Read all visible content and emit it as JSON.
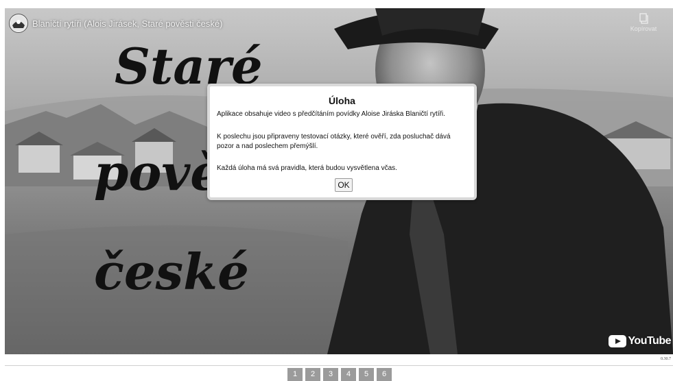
{
  "video": {
    "title": "Blaničtí rytíři (Alois Jirásek, Staré pověsti české)",
    "overlay_words": [
      "Staré",
      "pově",
      "české"
    ],
    "copy_label": "Kopírovat",
    "youtube_label": "YouTube"
  },
  "dialog": {
    "title": "Úloha",
    "paragraph1": "Aplikace obsahuje video s předčítáním povídky Aloise Jiráska Blaničtí rytíři.",
    "paragraph2": "K poslechu jsou připraveny testovací otázky, které ověří, zda posluchač dává pozor a nad poslechem přemýšlí.",
    "paragraph3": "Každá úloha má svá pravidla, která budou vysvětlena včas.",
    "ok_label": "OK"
  },
  "version": "0.30.7",
  "pagination": [
    "1",
    "2",
    "3",
    "4",
    "5",
    "6"
  ]
}
